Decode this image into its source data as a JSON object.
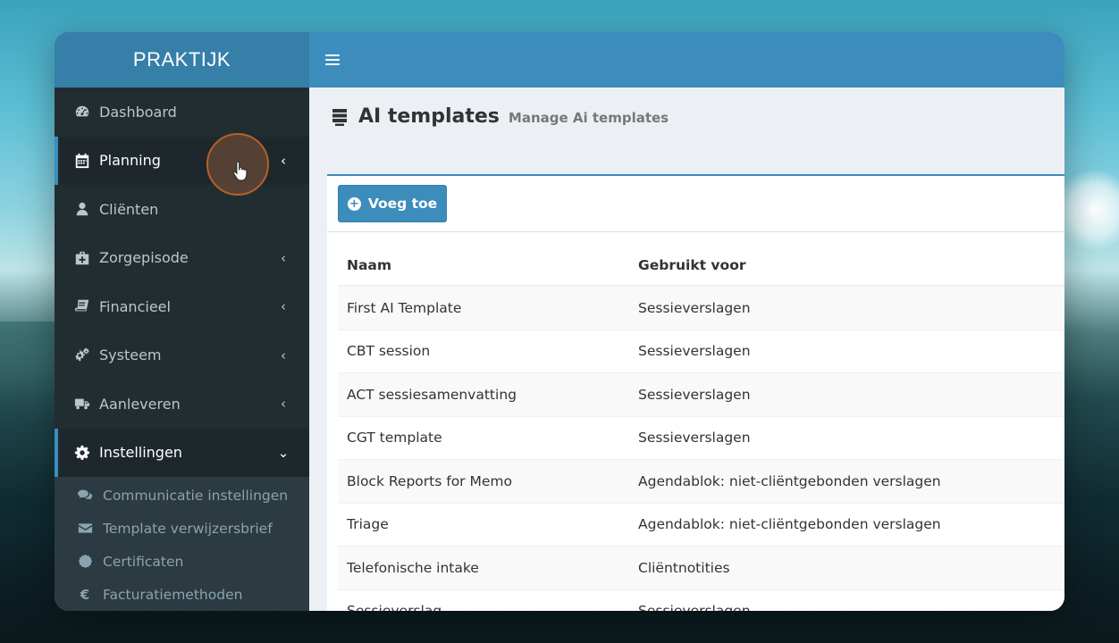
{
  "app": {
    "logo": "PRAKTIJK"
  },
  "sidebar": {
    "items": [
      {
        "label": "Dashboard",
        "icon": "dashboard-icon"
      },
      {
        "label": "Planning",
        "icon": "calendar-icon"
      },
      {
        "label": "Cliënten",
        "icon": "user-icon"
      },
      {
        "label": "Zorgepisode",
        "icon": "medkit-icon"
      },
      {
        "label": "Financieel",
        "icon": "book-icon"
      },
      {
        "label": "Systeem",
        "icon": "cogs-icon"
      },
      {
        "label": "Aanleveren",
        "icon": "truck-icon"
      },
      {
        "label": "Instellingen",
        "icon": "gear-icon"
      }
    ],
    "submenu": [
      {
        "label": "Communicatie instellingen",
        "icon": "comments-icon"
      },
      {
        "label": "Template verwijzersbrief",
        "icon": "envelope-icon"
      },
      {
        "label": "Certificaten",
        "icon": "certificate-icon"
      },
      {
        "label": "Facturatiemethoden",
        "icon": "euro-icon"
      }
    ]
  },
  "page": {
    "title": "AI templates",
    "subtitle": "Manage Ai templates",
    "add_button": "Voeg toe"
  },
  "table": {
    "headers": [
      "Naam",
      "Gebruikt voor"
    ],
    "rows": [
      [
        "First AI Template",
        "Sessieverslagen"
      ],
      [
        "CBT session",
        "Sessieverslagen"
      ],
      [
        "ACT sessiesamenvatting",
        "Sessieverslagen"
      ],
      [
        "CGT template",
        "Sessieverslagen"
      ],
      [
        "Block Reports for Memo",
        "Agendablok: niet-cliëntgebonden verslagen"
      ],
      [
        "Triage",
        "Agendablok: niet-cliëntgebonden verslagen"
      ],
      [
        "Telefonische intake",
        "Cliëntnotities"
      ],
      [
        "Sessieverslag",
        "Sessieverslagen"
      ]
    ]
  },
  "colors": {
    "accent": "#3c8dbc",
    "sidebar": "#222d32"
  }
}
